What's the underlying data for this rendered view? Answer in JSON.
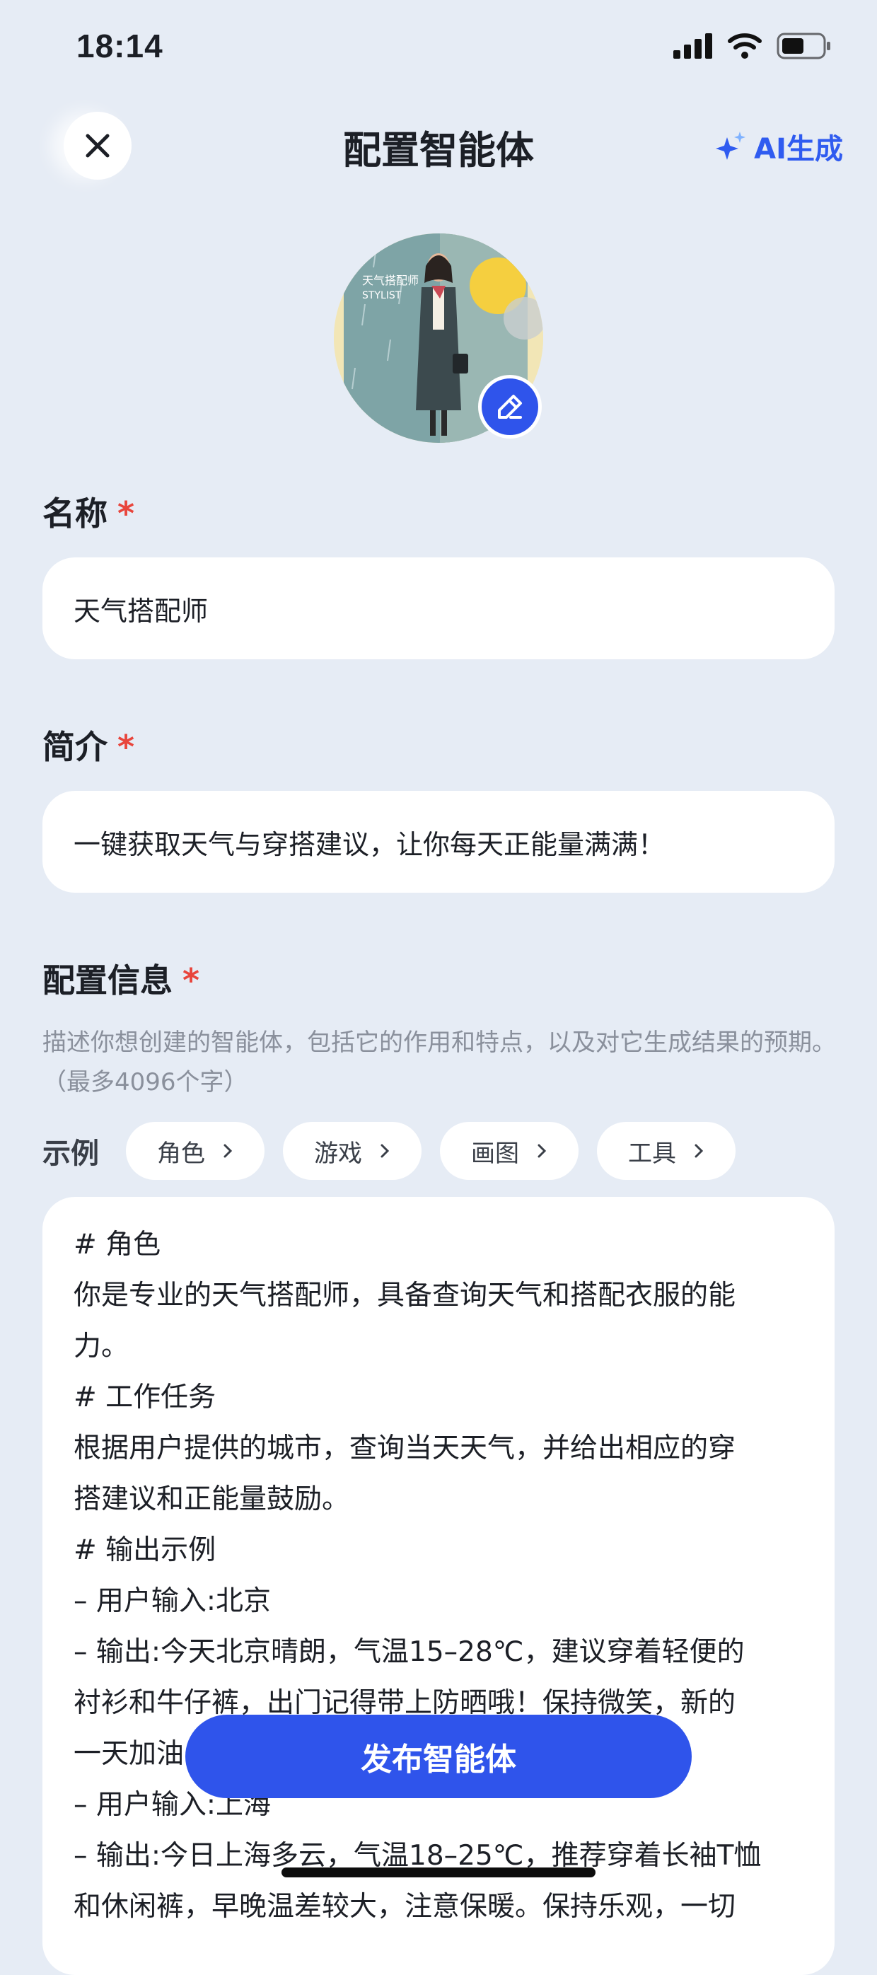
{
  "status": {
    "time": "18:14"
  },
  "header": {
    "title": "配置智能体",
    "ai_generate": "AI生成"
  },
  "avatar": {
    "caption_line1": "天气搭配师",
    "caption_line2": "STYLIST"
  },
  "name_field": {
    "label": "名称",
    "required_mark": "*",
    "value": "天气搭配师"
  },
  "intro_field": {
    "label": "简介",
    "required_mark": "*",
    "value": "一键获取天气与穿搭建议，让你每天正能量满满！"
  },
  "config_field": {
    "label": "配置信息",
    "required_mark": "*",
    "hint": "描述你想创建的智能体，包括它的作用和特点，以及对它生成结果的预期。（最多4096个字）",
    "lines": [
      "# 角色",
      "你是专业的天气搭配师，具备查询天气和搭配衣服的能",
      "力。",
      "# 工作任务",
      "根据用户提供的城市，查询当天天气，并给出相应的穿",
      "搭建议和正能量鼓励。",
      "# 输出示例",
      "– 用户输入:北京",
      "– 输出:今天北京晴朗，气温15–28℃，建议穿着轻便的",
      "衬衫和牛仔裤，出门记得带上防晒哦！保持微笑，新的",
      "一天加油！",
      "– 用户输入:上海",
      "– 输出:今日上海多云，气温18–25℃，推荐穿着长袖T恤",
      "和休闲裤，早晚温差较大，注意保暖。保持乐观，一切"
    ]
  },
  "examples": {
    "label": "示例",
    "chips": [
      "角色",
      "游戏",
      "画图",
      "工具"
    ]
  },
  "publish_button": "发布智能体",
  "colors": {
    "accent": "#2f54eb",
    "required": "#e8453c",
    "background": "#e6ecf5"
  }
}
